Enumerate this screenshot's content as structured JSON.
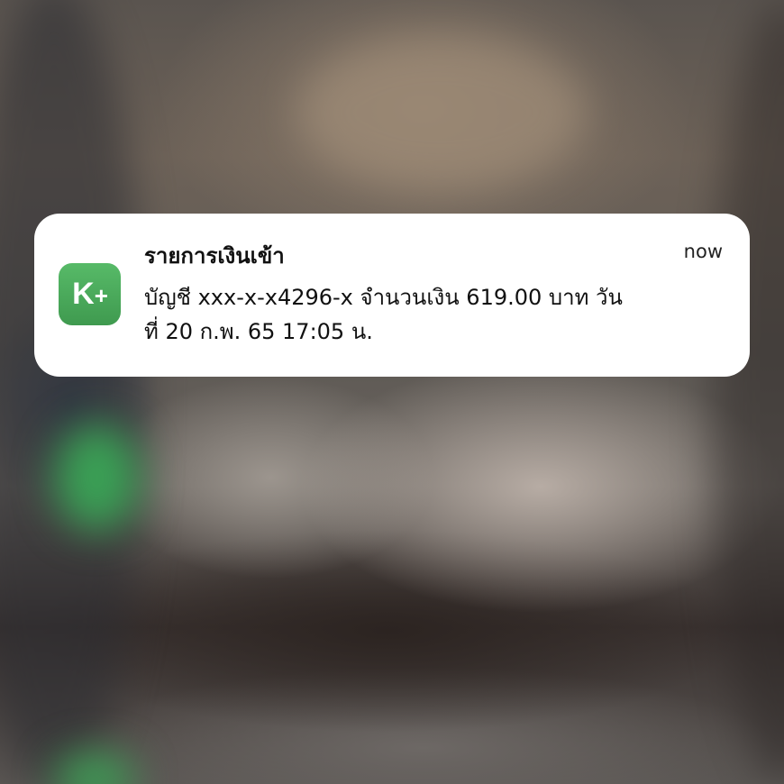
{
  "notification": {
    "app_icon_text": "K",
    "app_icon_plus": "+",
    "title": "รายการเงินเข้า",
    "time": "now",
    "body_lines": [
      "บัญชี xxx-x-x4296-x  จำนวนเงิน 619.00 บาท  วัน",
      "ที่ 20 ก.พ. 65  17:05 น."
    ]
  },
  "colors": {
    "app_icon_green": "#4caf5e",
    "card_background": "#ffffff"
  }
}
